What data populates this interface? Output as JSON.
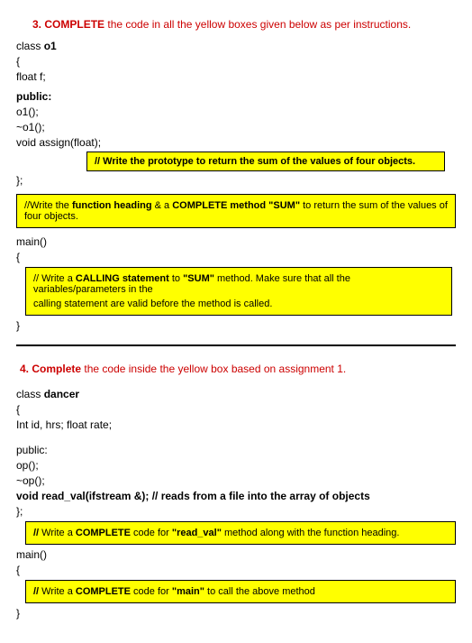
{
  "q3": {
    "number": "3.",
    "verb": "COMPLETE",
    "rest": " the code in all the yellow boxes given below as per instructions.",
    "class_decl": "class ",
    "class_name": "o1",
    "brace_open": "{",
    "float_f": "float f;",
    "public_label": "public:",
    "ctor": "o1();",
    "dtor": "~o1();",
    "assign": "void assign(float);",
    "box_proto": "// Write the prototype to return the sum of the values of four objects.",
    "brace_close": "};",
    "box_sum_pre": "//Write the ",
    "box_sum_bold1": "function heading",
    "box_sum_mid": " & a ",
    "box_sum_bold2": "COMPLETE method \"SUM\"",
    "box_sum_post": "  to return the sum of the values of four objects.",
    "main": "main()",
    "main_brace": "{",
    "box_call_l1_a": "// Write a ",
    "box_call_l1_b": "CALLING statement",
    "box_call_l1_c": " to ",
    "box_call_l1_d": "\"SUM\"",
    "box_call_l1_e": " method. Make sure that all the variables/parameters in the",
    "box_call_l2": "calling statement are valid before the method is called.",
    "main_close": "}"
  },
  "q4": {
    "number": "4.",
    "verb": "Complete",
    "rest": " the code inside the yellow box based on assignment 1.",
    "class_decl": "class ",
    "class_name": "dancer",
    "brace_open": "{",
    "members": "Int id, hrs; float rate;",
    "public_label": "public:",
    "ctor": "op();",
    "dtor": "~op();",
    "read_val": "void read_val(ifstream &); // reads from a file into the array of objects",
    "brace_close": "};",
    "box_readval_a": "// ",
    "box_readval_b": "Write a ",
    "box_readval_c": "COMPLETE",
    "box_readval_d": " code for ",
    "box_readval_e": "\"read_val\"",
    "box_readval_f": " method along with the function heading.",
    "main": "main()",
    "main_brace": "{",
    "box_main_a": "// ",
    "box_main_b": "Write a ",
    "box_main_c": "COMPLETE",
    "box_main_d": " code for ",
    "box_main_e": "\"main\"",
    "box_main_f": " to call the above method",
    "main_close": "}"
  }
}
